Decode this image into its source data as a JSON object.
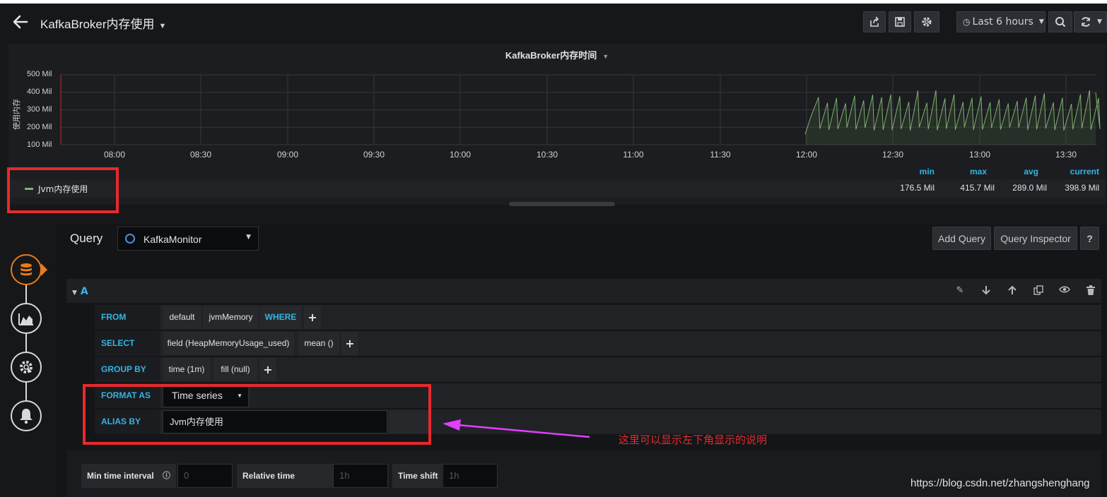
{
  "header": {
    "title": "KafkaBroker内存使用",
    "time_range": "Last 6 hours"
  },
  "panel": {
    "title": "KafkaBroker内存时间",
    "y_axis_label": "使用内存",
    "legend": {
      "series_name": "Jvm内存使用",
      "stat_headers": {
        "min": "min",
        "max": "max",
        "avg": "avg",
        "current": "current"
      },
      "stats": {
        "min": "176.5 Mil",
        "max": "415.7 Mil",
        "avg": "289.0 Mil",
        "current": "398.9 Mil"
      }
    }
  },
  "chart_data": {
    "type": "line",
    "title": "KafkaBroker内存时间",
    "ylabel": "使用内存",
    "y_ticks": [
      "500 Mil",
      "400 Mil",
      "300 Mil",
      "200 Mil",
      "100 Mil"
    ],
    "x_ticks": [
      "08:00",
      "08:30",
      "09:00",
      "09:30",
      "10:00",
      "10:30",
      "11:00",
      "11:30",
      "12:00",
      "12:30",
      "13:00",
      "13:30"
    ],
    "ylim": [
      100,
      500
    ],
    "grid": true,
    "series": [
      {
        "name": "Jvm内存使用",
        "color": "#7eb26d",
        "data_start": "12:00",
        "sawtooth_min": 180,
        "sawtooth_max": 415,
        "current": 398.9
      }
    ]
  },
  "editor": {
    "query_label": "Query",
    "datasource": "KafkaMonitor",
    "add_query": "Add Query",
    "query_inspector": "Query Inspector",
    "help": "?",
    "query_ref": "A",
    "from": {
      "keyword": "FROM",
      "policy": "default",
      "measurement": "jvmMemory",
      "where": "WHERE"
    },
    "select": {
      "keyword": "SELECT",
      "field": "field (HeapMemoryUsage_used)",
      "agg": "mean ()"
    },
    "group_by": {
      "keyword": "GROUP BY",
      "time": "time (1m)",
      "fill": "fill (null)"
    },
    "format_as": {
      "keyword": "FORMAT AS",
      "value": "Time series"
    },
    "alias_by": {
      "keyword": "ALIAS BY",
      "value": "Jvm内存使用"
    },
    "options": {
      "min_interval_label": "Min time interval",
      "min_interval_placeholder": "0",
      "relative_time_label": "Relative time",
      "relative_time_placeholder": "1h",
      "time_shift_label": "Time shift",
      "time_shift_placeholder": "1h"
    }
  },
  "annotation": {
    "note": "这里可以显示左下角显示的说明",
    "arrow_color": "#e040fb",
    "box_color": "#e8292d"
  },
  "watermark": "https://blog.csdn.net/zhangshenghang"
}
